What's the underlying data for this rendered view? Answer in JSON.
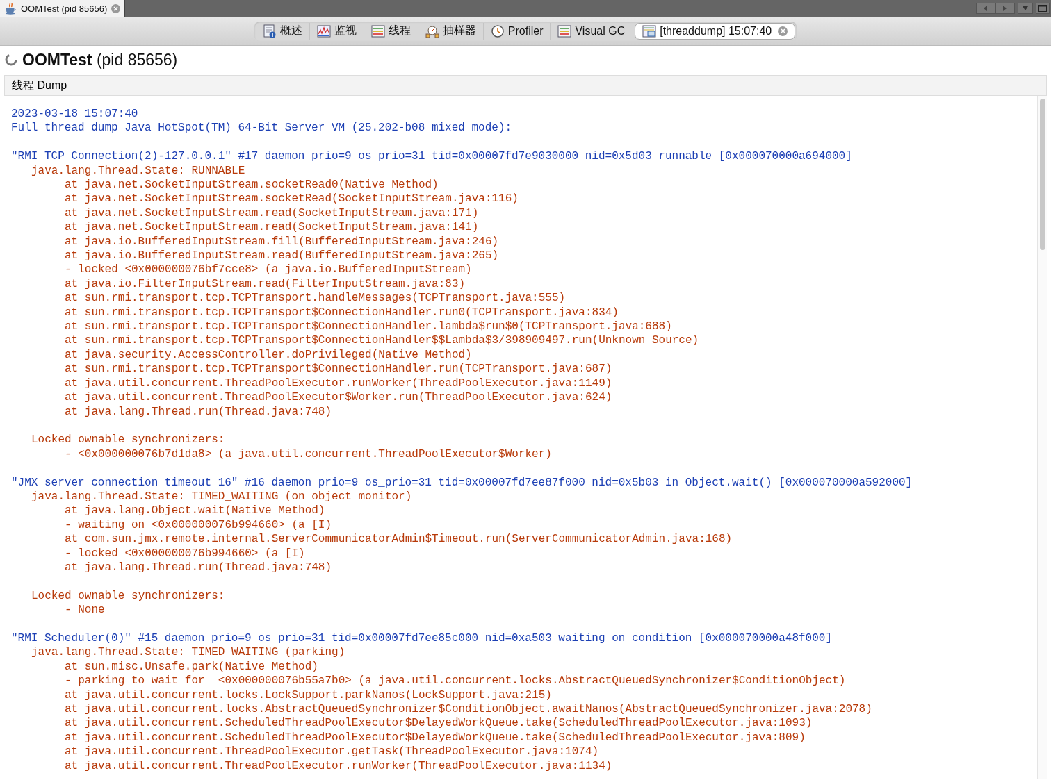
{
  "window": {
    "tab": {
      "title": "OOMTest (pid 85656)",
      "selected": true
    }
  },
  "view_tabs": [
    {
      "label": "概述",
      "selected": false,
      "closable": false
    },
    {
      "label": "监视",
      "selected": false,
      "closable": false
    },
    {
      "label": "线程",
      "selected": false,
      "closable": false
    },
    {
      "label": "抽样器",
      "selected": false,
      "closable": false
    },
    {
      "label": "Profiler",
      "selected": false,
      "closable": false
    },
    {
      "label": "Visual GC",
      "selected": false,
      "closable": false
    },
    {
      "label": "[threaddump] 15:07:40",
      "selected": true,
      "closable": true
    }
  ],
  "heading": "**OOMTest** (pid 85656)",
  "section_title": "线程 Dump",
  "dump": {
    "header": [
      "2023-03-18 15:07:40",
      "Full thread dump Java HotSpot(TM) 64-Bit Server VM (25.202-b08 mixed mode):"
    ],
    "threads": [
      {
        "title": "\"RMI TCP Connection(2)-127.0.0.1\" #17 daemon prio=9 os_prio=31 tid=0x00007fd7e9030000 nid=0x5d03 runnable [0x000070000a694000]",
        "lines": [
          {
            "kind": "state",
            "text": "java.lang.Thread.State: RUNNABLE"
          },
          {
            "kind": "frame",
            "text": "at java.net.SocketInputStream.socketRead0(Native Method)"
          },
          {
            "kind": "frame",
            "text": "at java.net.SocketInputStream.socketRead(SocketInputStream.java:116)"
          },
          {
            "kind": "frame",
            "text": "at java.net.SocketInputStream.read(SocketInputStream.java:171)"
          },
          {
            "kind": "frame",
            "text": "at java.net.SocketInputStream.read(SocketInputStream.java:141)"
          },
          {
            "kind": "frame",
            "text": "at java.io.BufferedInputStream.fill(BufferedInputStream.java:246)"
          },
          {
            "kind": "frame",
            "text": "at java.io.BufferedInputStream.read(BufferedInputStream.java:265)"
          },
          {
            "kind": "frame",
            "text": "- locked <0x000000076bf7cce8> (a java.io.BufferedInputStream)"
          },
          {
            "kind": "frame",
            "text": "at java.io.FilterInputStream.read(FilterInputStream.java:83)"
          },
          {
            "kind": "frame",
            "text": "at sun.rmi.transport.tcp.TCPTransport.handleMessages(TCPTransport.java:555)"
          },
          {
            "kind": "frame",
            "text": "at sun.rmi.transport.tcp.TCPTransport$ConnectionHandler.run0(TCPTransport.java:834)"
          },
          {
            "kind": "frame",
            "text": "at sun.rmi.transport.tcp.TCPTransport$ConnectionHandler.lambda$run$0(TCPTransport.java:688)"
          },
          {
            "kind": "frame",
            "text": "at sun.rmi.transport.tcp.TCPTransport$ConnectionHandler$$Lambda$3/398909497.run(Unknown Source)"
          },
          {
            "kind": "frame",
            "text": "at java.security.AccessController.doPrivileged(Native Method)"
          },
          {
            "kind": "frame",
            "text": "at sun.rmi.transport.tcp.TCPTransport$ConnectionHandler.run(TCPTransport.java:687)"
          },
          {
            "kind": "frame",
            "text": "at java.util.concurrent.ThreadPoolExecutor.runWorker(ThreadPoolExecutor.java:1149)"
          },
          {
            "kind": "frame",
            "text": "at java.util.concurrent.ThreadPoolExecutor$Worker.run(ThreadPoolExecutor.java:624)"
          },
          {
            "kind": "frame",
            "text": "at java.lang.Thread.run(Thread.java:748)"
          },
          {
            "kind": "section",
            "text": "Locked ownable synchronizers:"
          },
          {
            "kind": "frame",
            "text": "- <0x000000076b7d1da8> (a java.util.concurrent.ThreadPoolExecutor$Worker)"
          }
        ]
      },
      {
        "title": "\"JMX server connection timeout 16\" #16 daemon prio=9 os_prio=31 tid=0x00007fd7ee87f000 nid=0x5b03 in Object.wait() [0x000070000a592000]",
        "lines": [
          {
            "kind": "state",
            "text": "java.lang.Thread.State: TIMED_WAITING (on object monitor)"
          },
          {
            "kind": "frame",
            "text": "at java.lang.Object.wait(Native Method)"
          },
          {
            "kind": "frame",
            "text": "- waiting on <0x000000076b994660> (a [I)"
          },
          {
            "kind": "frame",
            "text": "at com.sun.jmx.remote.internal.ServerCommunicatorAdmin$Timeout.run(ServerCommunicatorAdmin.java:168)"
          },
          {
            "kind": "frame",
            "text": "- locked <0x000000076b994660> (a [I)"
          },
          {
            "kind": "frame",
            "text": "at java.lang.Thread.run(Thread.java:748)"
          },
          {
            "kind": "section",
            "text": "Locked ownable synchronizers:"
          },
          {
            "kind": "frame",
            "text": "- None"
          }
        ]
      },
      {
        "title": "\"RMI Scheduler(0)\" #15 daemon prio=9 os_prio=31 tid=0x00007fd7ee85c000 nid=0xa503 waiting on condition [0x000070000a48f000]",
        "lines": [
          {
            "kind": "state",
            "text": "java.lang.Thread.State: TIMED_WAITING (parking)"
          },
          {
            "kind": "frame",
            "text": "at sun.misc.Unsafe.park(Native Method)"
          },
          {
            "kind": "frame",
            "text": "- parking to wait for  <0x000000076b55a7b0> (a java.util.concurrent.locks.AbstractQueuedSynchronizer$ConditionObject)"
          },
          {
            "kind": "frame",
            "text": "at java.util.concurrent.locks.LockSupport.parkNanos(LockSupport.java:215)"
          },
          {
            "kind": "frame",
            "text": "at java.util.concurrent.locks.AbstractQueuedSynchronizer$ConditionObject.awaitNanos(AbstractQueuedSynchronizer.java:2078)"
          },
          {
            "kind": "frame",
            "text": "at java.util.concurrent.ScheduledThreadPoolExecutor$DelayedWorkQueue.take(ScheduledThreadPoolExecutor.java:1093)"
          },
          {
            "kind": "frame",
            "text": "at java.util.concurrent.ScheduledThreadPoolExecutor$DelayedWorkQueue.take(ScheduledThreadPoolExecutor.java:809)"
          },
          {
            "kind": "frame",
            "text": "at java.util.concurrent.ThreadPoolExecutor.getTask(ThreadPoolExecutor.java:1074)"
          },
          {
            "kind": "frame",
            "text": "at java.util.concurrent.ThreadPoolExecutor.runWorker(ThreadPoolExecutor.java:1134)"
          }
        ]
      }
    ]
  }
}
